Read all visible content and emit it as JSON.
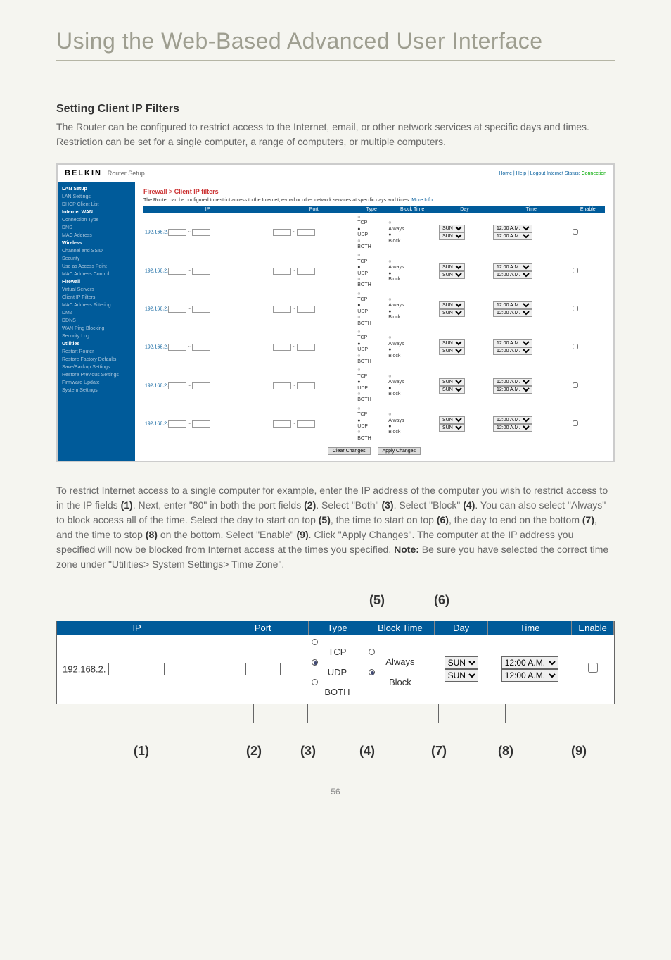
{
  "page_title": "Using the Web-Based Advanced User Interface",
  "section_heading": "Setting Client IP Filters",
  "intro_text": "The Router can be configured to restrict access to the Internet, email, or other network services at specific days and times. Restriction can be set for a single computer, a range of computers, or multiple computers.",
  "router": {
    "brand": "BELKIN",
    "setup": "Router Setup",
    "header_links": "Home | Help | Logout   Internet Status:",
    "status": "Connection",
    "sidebar": {
      "lan_setup": "LAN Setup",
      "lan_settings": "LAN Settings",
      "dhcp_client": "DHCP Client List",
      "internet_wan": "Internet WAN",
      "conn_type": "Connection Type",
      "dns": "DNS",
      "mac_addr": "MAC Address",
      "wireless": "Wireless",
      "channel_ssid": "Channel and SSID",
      "security": "Security",
      "use_ap": "Use as Access Point",
      "mac_ctrl": "MAC Address Control",
      "firewall": "Firewall",
      "virtual_srv": "Virtual Servers",
      "client_ip": "Client IP Filters",
      "mac_filter": "MAC Address Filtering",
      "dmz": "DMZ",
      "ddns": "DDNS",
      "wan_ping": "WAN Ping Blocking",
      "sec_log": "Security Log",
      "utilities": "Utilities",
      "restart": "Restart Router",
      "factory": "Restore Factory Defaults",
      "save_backup": "Save/Backup Settings",
      "restore_prev": "Restore Previous Settings",
      "fw_update": "Firmware Update",
      "sys_settings": "System Settings"
    },
    "filter_title": "Firewall > Client IP filters",
    "filter_desc": "The Router can be configured to restrict access to the Internet, e-mail or other network services at specific days and times.",
    "more_info": "More Info",
    "table_headers": {
      "ip": "IP",
      "port": "Port",
      "type": "Type",
      "block_time": "Block Time",
      "day": "Day",
      "time": "Time",
      "enable": "Enable"
    },
    "ip_prefix": "192.168.2.",
    "type_options": {
      "tcp": "TCP",
      "udp": "UDP",
      "both": "BOTH"
    },
    "block_options": {
      "always": "Always",
      "block": "Block"
    },
    "day_value": "SUN",
    "time_value": "12:00 A.M.",
    "btn_clear": "Clear Changes",
    "btn_apply": "Apply Changes"
  },
  "instructions": {
    "p1": "To restrict Internet access to a single computer for example, enter the IP address of the computer you wish to restrict access to in the IP fields ",
    "b1": "(1)",
    "p2": ". Next, enter \"80\" in both the port fields ",
    "b2": "(2)",
    "p3": ". Select \"Both\" ",
    "b3": "(3)",
    "p4": ". Select \"Block\" ",
    "b4": "(4)",
    "p5": ". You can also select \"Always\" to block access all of the time. Select the day to start on top ",
    "b5": "(5)",
    "p6": ", the time to start on top ",
    "b6": "(6)",
    "p7": ", the day to end on the bottom ",
    "b7": "(7)",
    "p8": ", and the time to stop ",
    "b8": "(8)",
    "p9": " on the bottom. Select \"Enable\" ",
    "b9": "(9)",
    "p10": ". Click \"Apply Changes\". The computer at the IP address you specified will now be blocked from Internet access at the times you specified. ",
    "note_label": "Note:",
    "note_text": " Be sure you have selected the correct time zone under \"Utilities> System Settings> Time Zone\"."
  },
  "callouts": {
    "c1": "(1)",
    "c2": "(2)",
    "c3": "(3)",
    "c4": "(4)",
    "c5": "(5)",
    "c6": "(6)",
    "c7": "(7)",
    "c8": "(8)",
    "c9": "(9)"
  },
  "page_number": "56"
}
